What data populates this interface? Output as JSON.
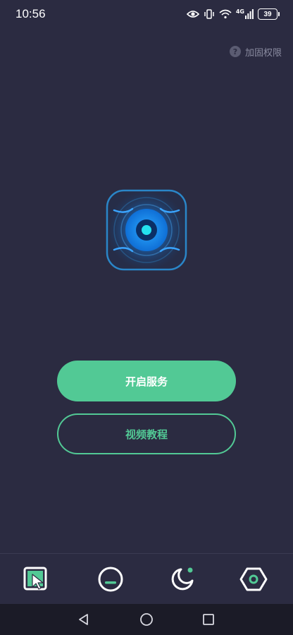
{
  "status_bar": {
    "time": "10:56",
    "network": "4G",
    "battery": "39"
  },
  "header": {
    "reinforce_label": "加固权限",
    "help_icon_glyph": "?"
  },
  "main": {
    "logo_icon": "eye-scanner-icon",
    "start_service_label": "开启服务",
    "video_tutorial_label": "视频教程"
  },
  "tab_bar": {
    "items": [
      {
        "icon": "cursor-click-icon",
        "active": true
      },
      {
        "icon": "minus-circle-icon",
        "active": false
      },
      {
        "icon": "moon-icon",
        "active": false,
        "badge": true
      },
      {
        "icon": "hexagon-nut-icon",
        "active": false
      }
    ]
  },
  "colors": {
    "background": "#2b2b41",
    "accent": "#52c995",
    "logo_blue": "#1e9bff"
  }
}
